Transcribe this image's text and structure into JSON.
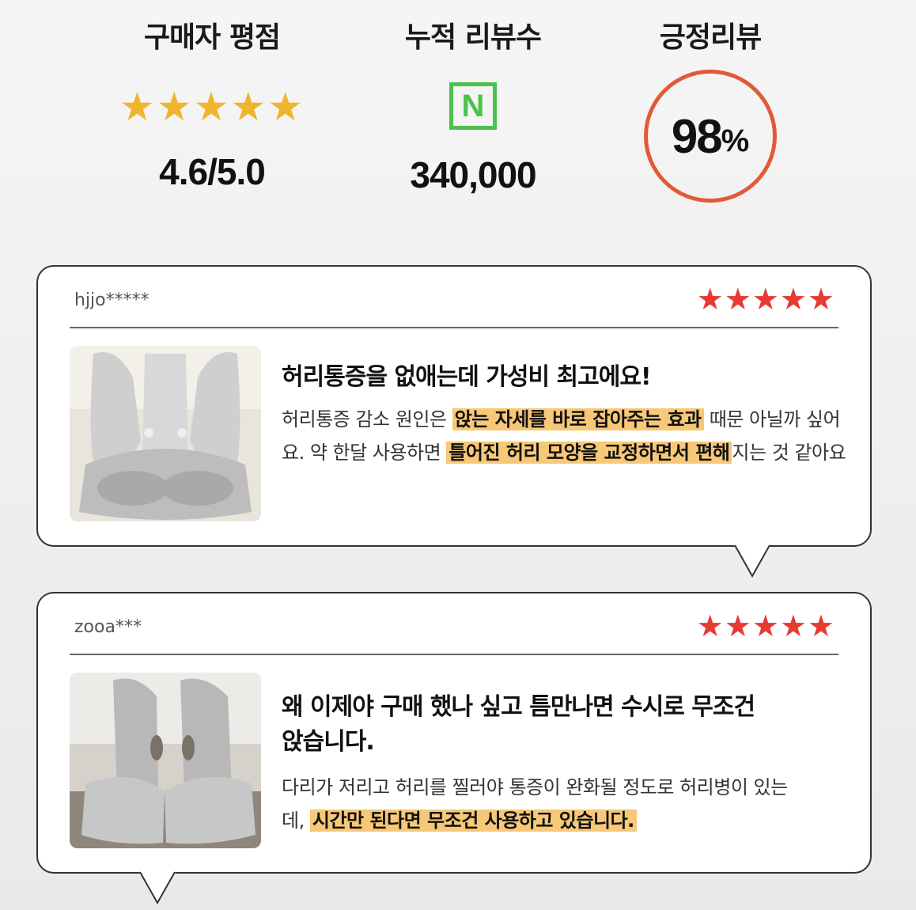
{
  "stats": [
    {
      "title": "구매자 평점",
      "stars": "★★★★★",
      "value": "4.6/5.0"
    },
    {
      "title": "누적 리뷰수",
      "badge": "N",
      "value": "340,000"
    },
    {
      "title": "긍정리뷰",
      "percent": "98",
      "percent_sign": "%"
    }
  ],
  "colors": {
    "gold_star": "#efb52c",
    "red_star": "#e63a33",
    "naver_green": "#4cc24c",
    "circle_orange": "#e05a3a",
    "highlight": "#f7c877"
  },
  "reviews": [
    {
      "user": "hjjo*****",
      "stars": "★★★★★",
      "headline": "허리통증을 없애는데 가성비 최고에요!",
      "body": [
        {
          "text": "허리통증 감소 원인은 ",
          "hl": false
        },
        {
          "text": "앉는 자세를 바로 잡아주는 효과",
          "hl": true
        },
        {
          "text": " 때문 아닐까 싶어요. 약 한달 사용하면 ",
          "hl": false
        },
        {
          "text": "틀어진 허리 모양을 교정하면서 편해",
          "hl": true
        },
        {
          "text": "지는 것 같아요",
          "hl": false
        }
      ]
    },
    {
      "user": "zooa***",
      "stars": "★★★★★",
      "headline": "왜 이제야 구매 했나 싶고 틈만나면 수시로 무조건 앉습니다.",
      "body": [
        {
          "text": "다리가 저리고 허리를 찔러야 통증이 완화될 정도로 허리병이 있는데, ",
          "hl": false
        },
        {
          "text": "시간만 된다면 무조건 사용하고 있습니다.",
          "hl": true
        }
      ]
    }
  ]
}
